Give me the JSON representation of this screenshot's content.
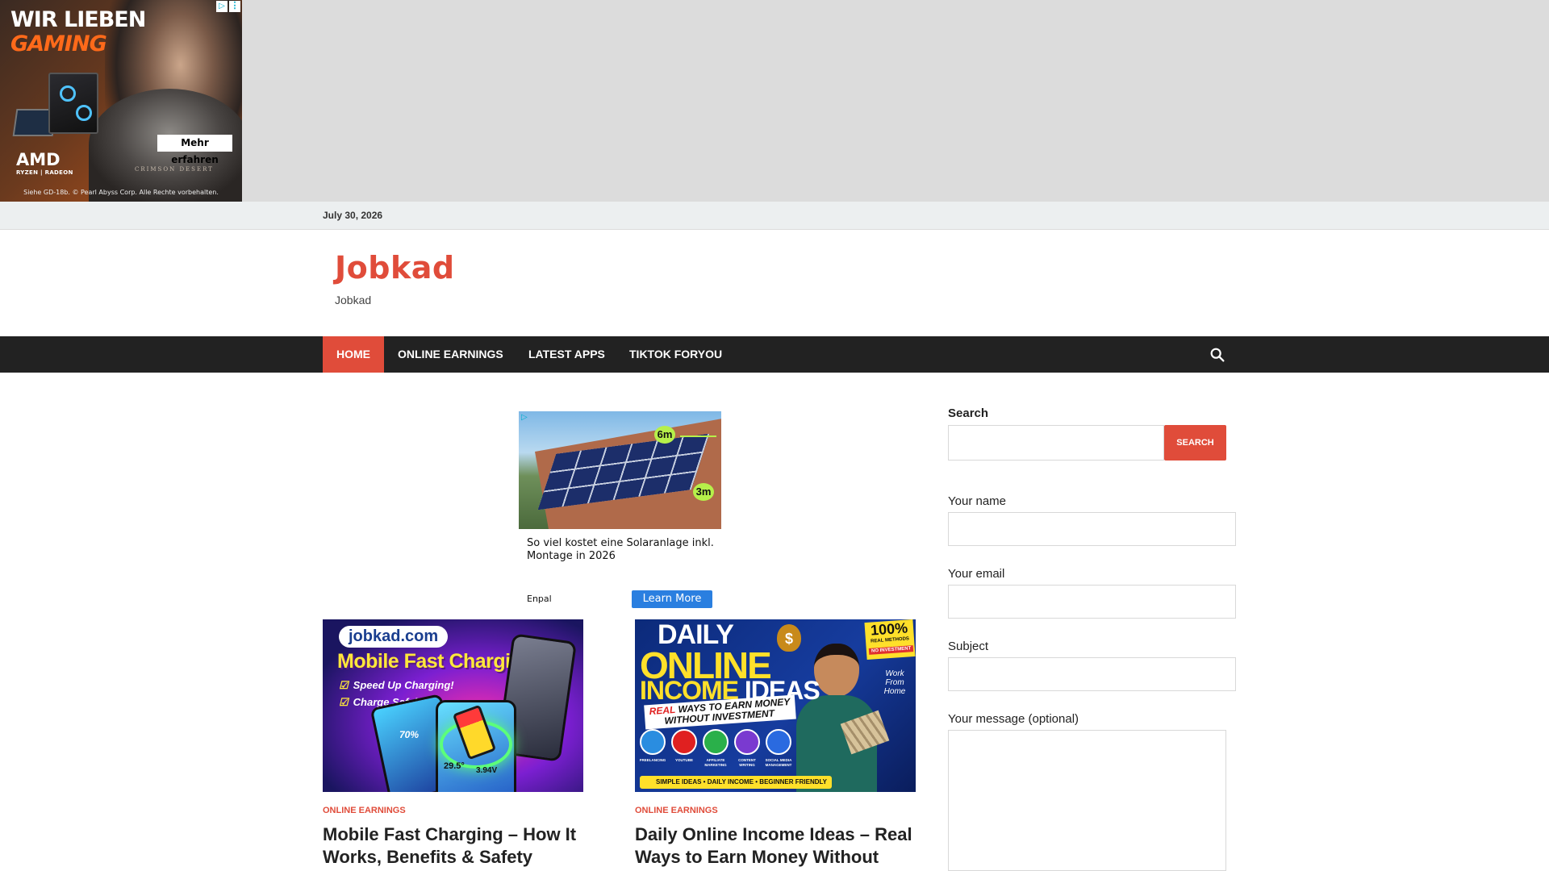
{
  "top_ad": {
    "headline_line1": "WIR LIEBEN",
    "headline_line2": "GAMING",
    "cta": "Mehr erfahren",
    "brand": "AMD",
    "subbrand": "RYZEN | RADEON",
    "game_logo": "CRIMSON DESERT",
    "legal": "Siehe GD-18b. © Pearl Abyss Corp. Alle Rechte vorbehalten.",
    "adchoices_icon": "ad-choices-icon",
    "options_icon": "vertical-dots-icon",
    "colors": {
      "band": "#dcdcdc",
      "accent": "#ff6a1a"
    }
  },
  "date_bar": {
    "date": "July 30, 2026"
  },
  "header": {
    "title": "Jobkad",
    "tagline": "Jobkad"
  },
  "nav": {
    "items": [
      {
        "label": "HOME",
        "active": true
      },
      {
        "label": "ONLINE EARNINGS",
        "active": false
      },
      {
        "label": "LATEST APPS",
        "active": false
      },
      {
        "label": "TIKTOK FORYOU",
        "active": false
      }
    ],
    "search_icon": "search-icon"
  },
  "content_ad": {
    "badge_top": "6m",
    "badge_bottom": "3m",
    "title": "So viel kostet eine Solaranlage inkl. Montage in 2026",
    "advertiser": "Enpal",
    "cta": "Learn More"
  },
  "posts": [
    {
      "category": "ONLINE EARNINGS",
      "title": "Mobile Fast Charging – How It Works, Benefits & Safety Guide",
      "image": {
        "site": "jobkad.com",
        "headline": "Mobile Fast Charging",
        "check1": "Speed Up Charging!",
        "check2": "Charge Safely!",
        "percent": "70%",
        "reading1": "29.5°",
        "reading2": "3.94V"
      }
    },
    {
      "category": "ONLINE EARNINGS",
      "title": "Daily Online Income Ideas – Real Ways to Earn Money Without",
      "image": {
        "line1": "DAILY",
        "line2": "ONLINE",
        "line3a": "INCOME",
        "line3b": "IDEAS",
        "badge_pct": "100%",
        "badge_sub": "REAL METHODS",
        "no_investment": "NO INVESTMENT",
        "wfh": "Work From Home",
        "ribbon_real": "REAL",
        "ribbon_rest": "WAYS TO EARN MONEY",
        "ribbon_line2": "WITHOUT INVESTMENT",
        "icons": [
          {
            "caption": "FREELANCING",
            "color": "#2a8de0"
          },
          {
            "caption": "YOUTUBE",
            "color": "#e02020"
          },
          {
            "caption": "AFFILIATE MARKETING",
            "color": "#2ab04a"
          },
          {
            "caption": "CONTENT WRITING",
            "color": "#7a3ad0"
          },
          {
            "caption": "SOCIAL MEDIA MANAGEMENT",
            "color": "#2a6ae0"
          }
        ],
        "footer": "SIMPLE IDEAS • DAILY INCOME • BEGINNER FRIENDLY"
      }
    }
  ],
  "sidebar": {
    "search_label": "Search",
    "search_button": "SEARCH",
    "name_label": "Your name",
    "email_label": "Your email",
    "subject_label": "Subject",
    "message_label": "Your message (optional)"
  },
  "colors": {
    "brand": "#e04c3a",
    "nav_bg": "#222222",
    "date_bar_bg": "#eceff0"
  }
}
